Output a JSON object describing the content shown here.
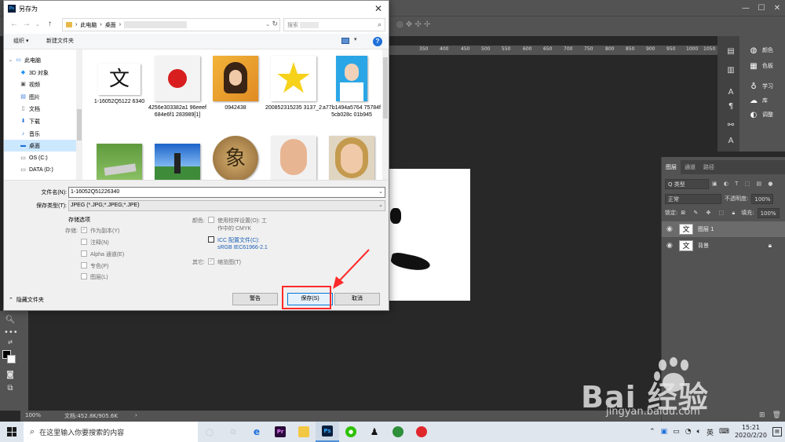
{
  "dialog": {
    "title": "另存为",
    "close_glyph": "✕",
    "address": {
      "crumb1": "此电脑",
      "sep": "›",
      "crumb2": "桌面",
      "sep2": "›"
    },
    "search_placeholder": "搜索",
    "organize": "组织 ▾",
    "new_folder": "新建文件夹",
    "help": "?",
    "nav_items": [
      {
        "label": "此电脑",
        "icon": "computer-icon"
      },
      {
        "label": "3D 对象",
        "icon": "3d-objects-icon"
      },
      {
        "label": "视频",
        "icon": "video-icon"
      },
      {
        "label": "图片",
        "icon": "pictures-icon"
      },
      {
        "label": "文档",
        "icon": "documents-icon"
      },
      {
        "label": "下载",
        "icon": "downloads-icon"
      },
      {
        "label": "音乐",
        "icon": "music-icon"
      },
      {
        "label": "桌面",
        "icon": "desktop-icon"
      },
      {
        "label": "OS (C:)",
        "icon": "drive-icon"
      },
      {
        "label": "DATA (D:)",
        "icon": "drive-icon"
      }
    ],
    "files": [
      {
        "name": "1-16052Q5122 6340",
        "thumb_text": "文"
      },
      {
        "name": "4256e303382a1 96eeef684e6f1 283989[1]",
        "thumb_text": ""
      },
      {
        "name": "0942438",
        "thumb_text": ""
      },
      {
        "name": "200852315235 3137_2",
        "thumb_text": ""
      },
      {
        "name": "a77b1494a5764 75784f5cb028c 01b945",
        "thumb_text": ""
      },
      {
        "name": "",
        "thumb_text": ""
      },
      {
        "name": "",
        "thumb_text": ""
      },
      {
        "name": "",
        "thumb_text": "象"
      },
      {
        "name": "",
        "thumb_text": ""
      },
      {
        "name": "",
        "thumb_text": ""
      }
    ],
    "filename_label": "文件名(N):",
    "filename_value": "1-16052Q51226340",
    "filetype_label": "保存类型(T):",
    "filetype_value": "JPEG (*.JPG;*.JPEG;*.JPE)",
    "options": {
      "heading": "存储选项",
      "store_label": "存储:",
      "as_copy": "作为副本(Y)",
      "notes": "注释(N)",
      "alpha": "Alpha 通道(E)",
      "spot": "专色(P)",
      "layers": "图层(L)",
      "color_label": "颜色:",
      "proof_setup": "使用校样设置(O): 工",
      "proof_setup_2": "作中的 CMYK",
      "icc": "ICC 配置文件(C):",
      "icc_profile": "sRGB IEC61966-2.1",
      "other_label": "其它:",
      "thumbnail": "缩览图(T)"
    },
    "hide_folders": "隐藏文件夹",
    "btn_warning": "警告",
    "btn_save": "保存(S)",
    "btn_cancel": "取消"
  },
  "photoshop": {
    "ruler_numbers": [
      "350",
      "400",
      "450",
      "500",
      "550",
      "600",
      "650",
      "700",
      "750",
      "800",
      "850",
      "900",
      "950",
      "1000",
      "1050"
    ],
    "panel_items": [
      "颜色",
      "色板",
      "学习",
      "库",
      "调整"
    ],
    "layers_tabs": [
      "图层",
      "通道",
      "路径"
    ],
    "kind_filter": "Q 类型",
    "blend_mode": "正常",
    "opacity_label": "不透明度:",
    "opacity_value": "100%",
    "lock_label": "锁定:",
    "fill_label": "填充:",
    "fill_value": "100%",
    "layers": [
      {
        "name": "图层 1",
        "thumb": "文"
      },
      {
        "name": "背景",
        "thumb": "文"
      }
    ],
    "zoom": "100%",
    "doc_info": "文档:452.8K/905.6K"
  },
  "taskbar": {
    "search_placeholder": "在这里输入你要搜索的内容",
    "ime": "英",
    "time": "15:21",
    "date": "2020/2/20"
  },
  "watermark": {
    "brand": "Bai  经验",
    "url": "jingyan.baidu.com"
  },
  "colors": {
    "ps_bg": "#282828",
    "ps_panel": "#535353",
    "dialog_bg": "#f0f0f0",
    "highlight_red": "#ff2a2a",
    "accent_blue": "#0078d7"
  }
}
